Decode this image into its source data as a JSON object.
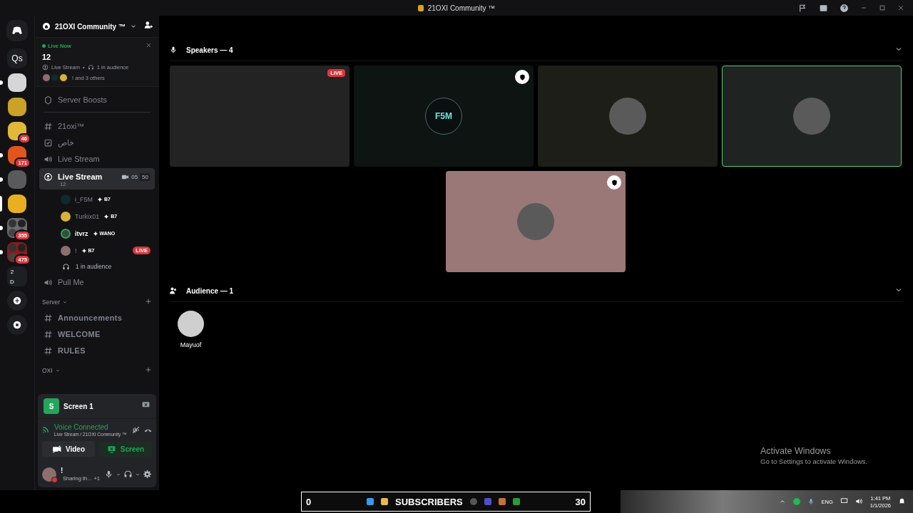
{
  "window": {
    "title": "21OXI Community ™"
  },
  "servers": [
    {
      "kind": "text",
      "label": "Qs",
      "unread": false,
      "selected": false
    },
    {
      "kind": "image",
      "color": "#d6d6d6",
      "unread": true,
      "selected": false
    },
    {
      "kind": "image",
      "color": "#c9a227",
      "unread": false,
      "selected": false
    },
    {
      "kind": "image",
      "color": "#e0b93a",
      "badge": "46",
      "unread": false,
      "selected": false
    },
    {
      "kind": "image",
      "color": "#e2551c",
      "badge": "171",
      "unread": true,
      "selected": false
    },
    {
      "kind": "image",
      "color": "#5a5a5a",
      "unread": true,
      "selected": false
    },
    {
      "kind": "image",
      "color": "#e8b020",
      "unread": false,
      "selected": true
    },
    {
      "kind": "folder",
      "color": "#6a6a6a",
      "badge": "355",
      "unread": true,
      "selected": false
    },
    {
      "kind": "folder",
      "color": "#8a1c1c",
      "badge": "475",
      "unread": true,
      "selected": false
    },
    {
      "kind": "folder_text",
      "labels": [
        "2",
        "D"
      ],
      "unread": false,
      "selected": false
    }
  ],
  "server_header": {
    "name": "21OXI Community ™"
  },
  "live_popup": {
    "status": "Live Now",
    "title": "12",
    "channel": "Live Stream",
    "separator": "•",
    "audience": "1 in audience",
    "others": "! and 3 others"
  },
  "server_boosts": "Server Boosts",
  "channels": [
    {
      "kind": "text",
      "name": "21oxi™",
      "selected": false
    },
    {
      "kind": "rules",
      "name": "خاص",
      "selected": false
    },
    {
      "kind": "voice",
      "name": "Live Stream",
      "selected": false
    },
    {
      "kind": "stage",
      "name": "Live Stream",
      "selected": true,
      "topic": "12",
      "video_count": "05",
      "limit": "50",
      "participants": [
        {
          "name": "i_F5M",
          "tag": "B7",
          "speaking": false,
          "live": false,
          "color": "#0e2a2a"
        },
        {
          "name": "Turkix01",
          "tag": "B7",
          "speaking": false,
          "live": false,
          "color": "#d8b13a"
        },
        {
          "name": "itvrz",
          "tag": "WANO",
          "speaking": true,
          "live": false,
          "color": "#3b4a3a"
        },
        {
          "name": "!",
          "tag": "B7",
          "speaking": false,
          "live": true,
          "live_label": "LIVE",
          "color": "#8e6e6e"
        }
      ],
      "audience": "1 in audience"
    },
    {
      "kind": "voice",
      "name": "Pull Me",
      "selected": false
    }
  ],
  "categories": [
    {
      "name": "Server",
      "channels": [
        {
          "kind": "announcement",
          "name": "Announcements"
        },
        {
          "kind": "announcement",
          "name": "WELCOME"
        },
        {
          "kind": "announcement",
          "name": "RULES"
        }
      ]
    },
    {
      "name": "OXI"
    }
  ],
  "stream_card": {
    "title": "Screen 1",
    "initial": "S"
  },
  "voice": {
    "status": "Voice Connected",
    "location": "Live Stream / 21OXI Community ™"
  },
  "media_buttons": [
    {
      "label": "Video",
      "kind": "video",
      "on": false
    },
    {
      "label": "Screen",
      "kind": "screen",
      "on": true
    }
  ],
  "user": {
    "name": "!",
    "activity": "Sharing th...",
    "extra": "+1"
  },
  "speakers": {
    "title": "Speakers — 4",
    "tiles": [
      {
        "kind": "blank",
        "color": "#232323",
        "live": true,
        "live_label": "LIVE",
        "moderator": false,
        "speaking": false
      },
      {
        "kind": "logo",
        "label": "F5M",
        "color": "#0d1412",
        "live": false,
        "moderator": true,
        "speaking": false
      },
      {
        "kind": "avatar",
        "color": "#1e1e19",
        "live": false,
        "moderator": false,
        "speaking": false
      },
      {
        "kind": "avatar",
        "color": "#1f2321",
        "live": false,
        "moderator": false,
        "speaking": true
      },
      {
        "kind": "avatar",
        "color": "#9a7878",
        "live": false,
        "moderator": true,
        "speaking": false
      }
    ]
  },
  "audience": {
    "title": "Audience — 1",
    "members": [
      {
        "name": "Mayuof"
      }
    ]
  },
  "activation": {
    "title": "Activate Windows",
    "hint": "Go to Settings to activate Windows."
  },
  "taskbar": {
    "left_count": "0",
    "banner": "SUBSCRIBERS",
    "right_count": "30",
    "language": "ENG",
    "time": "1:41 PM",
    "date": "1/1/2026"
  }
}
